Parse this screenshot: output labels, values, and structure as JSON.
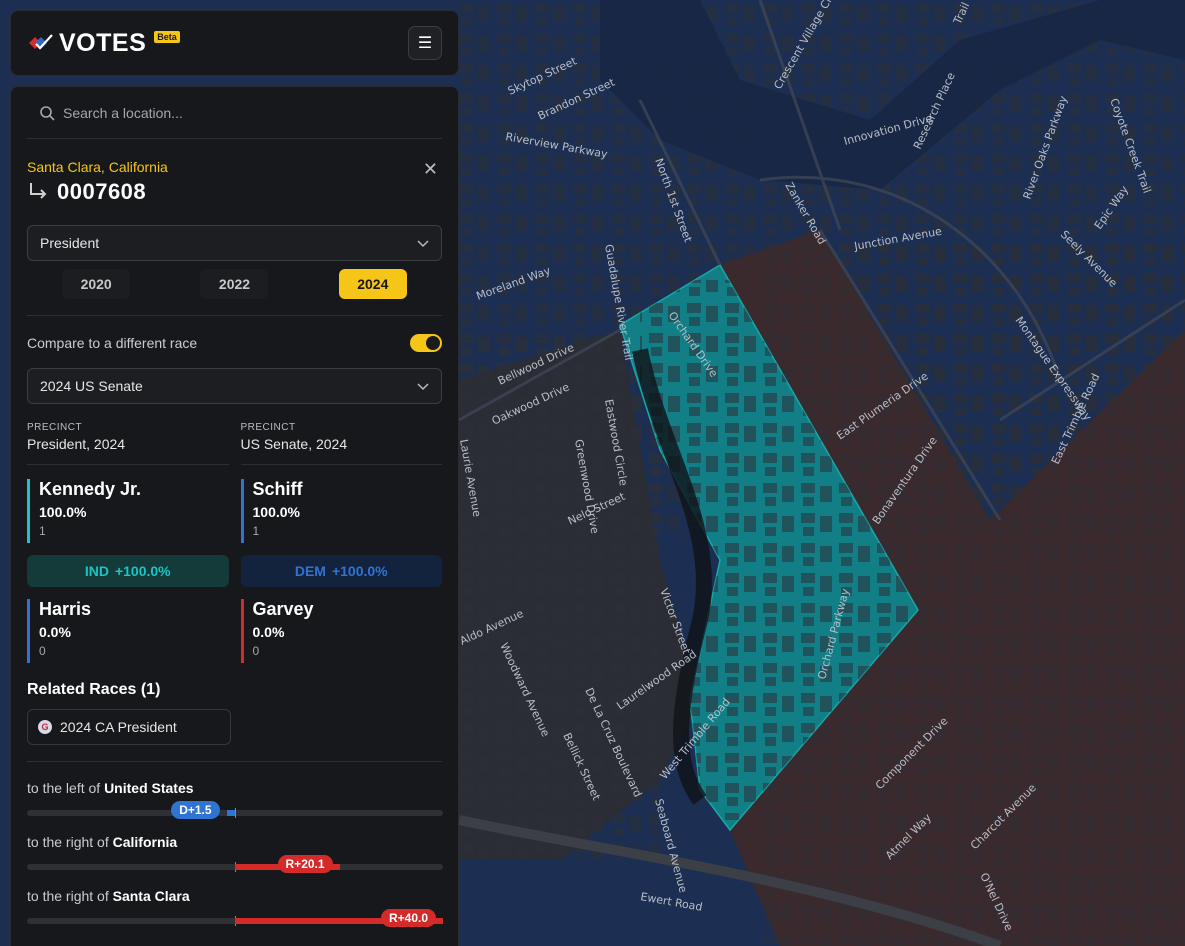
{
  "header": {
    "app_name": "VOTES",
    "badge": "Beta",
    "menu_icon": "hamburger-icon"
  },
  "search": {
    "placeholder": "Search a location..."
  },
  "location": {
    "name": "Santa Clara, California",
    "precinct_id": "0007608"
  },
  "race_select": {
    "value": "President"
  },
  "years": [
    "2020",
    "2022",
    "2024"
  ],
  "active_year": "2024",
  "compare": {
    "label": "Compare to a different race",
    "enabled": true,
    "race": "2024 US Senate"
  },
  "columns": [
    {
      "kicker": "PRECINCT",
      "title": "President, 2024",
      "candidates": [
        {
          "name": "Kennedy Jr.",
          "pct": "100.0%",
          "votes": "1",
          "color": "#1cc5c5"
        },
        {
          "name": "Harris",
          "pct": "0.0%",
          "votes": "0",
          "color": "#2f73d3"
        }
      ],
      "margin": {
        "party": "IND",
        "value": "+100.0%"
      }
    },
    {
      "kicker": "PRECINCT",
      "title": "US Senate, 2024",
      "candidates": [
        {
          "name": "Schiff",
          "pct": "100.0%",
          "votes": "1",
          "color": "#2f73d3"
        },
        {
          "name": "Garvey",
          "pct": "0.0%",
          "votes": "0",
          "color": "#d42a2a"
        }
      ],
      "margin": {
        "party": "DEM",
        "value": "+100.0%"
      }
    }
  ],
  "related": {
    "title": "Related Races (1)",
    "items": [
      {
        "label": "2024 CA President"
      }
    ]
  },
  "leans": [
    {
      "prefix": "to the left of",
      "place": "United States",
      "badge": "D+1.5",
      "party": "D",
      "value": 1.5
    },
    {
      "prefix": "to the right of",
      "place": "California",
      "badge": "R+20.1",
      "party": "R",
      "value": 20.1
    },
    {
      "prefix": "to the right of",
      "place": "Santa Clara",
      "badge": "R+40.0",
      "party": "R",
      "value": 40.0
    }
  ],
  "lean_scale_max": 40,
  "colors": {
    "accent": "#f5c518",
    "dem": "#2f73d3",
    "rep": "#d42a2a",
    "ind": "#1cc5c5"
  },
  "map": {
    "streets": [
      "Skytop Street",
      "Brandon Street",
      "Riverview Parkway",
      "North 1st Street",
      "Crescent Village Circle",
      "Innovation Drive",
      "Research Place",
      "Zanker Road",
      "River Oaks Parkway",
      "Coyote Creek Trail",
      "Epic Way",
      "Seely Avenue",
      "Junction Avenue",
      "Montague Expressway",
      "Moreland Way",
      "Guadalupe River Trail",
      "Orchard Drive",
      "Bellwood Drive",
      "Oakwood Drive",
      "Eastwood Circle",
      "Greenwood Drive",
      "Laurie Avenue",
      "Nelo Street",
      "East Plumeria Drive",
      "East Trimble Road",
      "Bonaventura Drive",
      "Victor Street",
      "Aldo Avenue",
      "Woodward Avenue",
      "Laurelwood Road",
      "West Trimble Road",
      "Orchard Parkway",
      "De La Cruz Boulevard",
      "Bellick Street",
      "Seaboard Avenue",
      "Ewert Road",
      "Component Drive",
      "Charcot Avenue",
      "Atmel Way",
      "O'Nel Drive",
      "Trail"
    ]
  }
}
